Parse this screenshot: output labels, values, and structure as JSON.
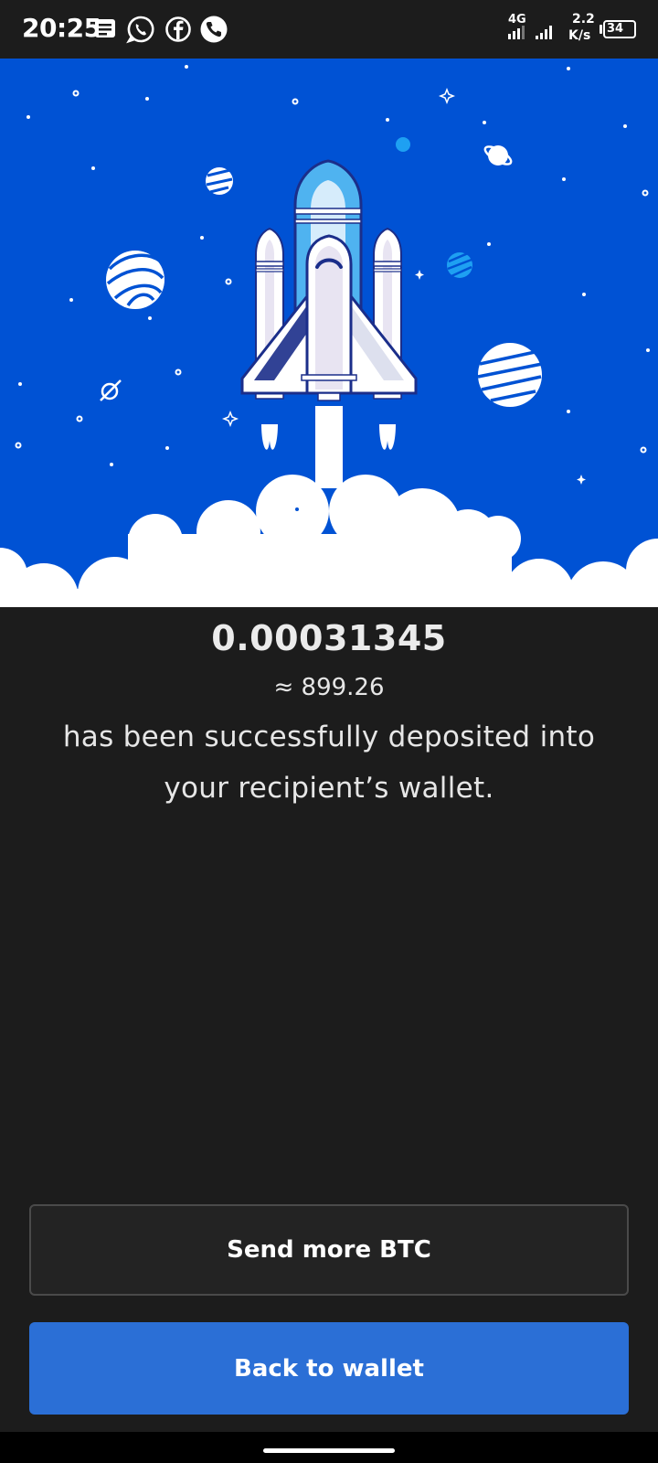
{
  "status_bar": {
    "time": "20:25",
    "network": "4G",
    "speed_value": "2.2",
    "speed_unit": "K/s",
    "battery": "34",
    "notification_icons": [
      "message-icon",
      "whatsapp-icon",
      "facebook-icon",
      "phone-icon"
    ]
  },
  "result": {
    "amount": "0.00031345",
    "fiat": "≈ 899.26",
    "message": "has been successfully deposited into your recipient’s wallet."
  },
  "actions": {
    "send_more_label": "Send more BTC",
    "back_label": "Back to wallet"
  },
  "colors": {
    "hero_background": "#0052d4",
    "primary_button": "#2b6fd6",
    "page_background": "#1c1c1c"
  }
}
